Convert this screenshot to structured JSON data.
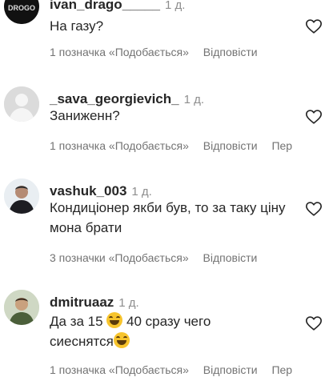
{
  "comments": [
    {
      "username": "ivan_drago_____",
      "time": "1 д.",
      "text": "На газу?",
      "likes_label": "1 позначка «Подобається»",
      "reply_label": "Відповісти"
    },
    {
      "username": "_sava_georgievich_",
      "time": "1 д.",
      "text": "Заниженн?",
      "likes_label": "1 позначка «Подобається»",
      "reply_label": "Відповісти",
      "extra_label": "Пер"
    },
    {
      "username": "vashuk_003",
      "time": "1 д.",
      "text": "Кондиціонер якби був, то за таку ціну мона брати",
      "likes_label": "3 позначки «Подобається»",
      "reply_label": "Відповісти"
    },
    {
      "username": "dmitruaaz",
      "time": "1 д.",
      "text_parts": [
        "Да за 15 ",
        " 40 сразу чего сиеснятся"
      ],
      "likes_label": "1 позначка «Подобається»",
      "reply_label": "Відповісти",
      "extra_label": "Пер"
    }
  ],
  "icons": {
    "like": "heart-outline-icon",
    "emoji": "grinning-face-with-sweat-emoji"
  },
  "colors": {
    "username": "#262626",
    "meta": "#8e8e8e",
    "action": "#737373"
  }
}
